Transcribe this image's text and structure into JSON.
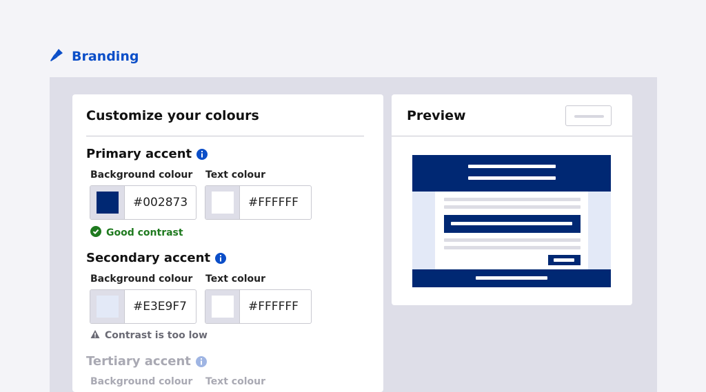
{
  "header": {
    "title": "Branding",
    "icon": "pen-nib-icon"
  },
  "customize": {
    "title": "Customize your colours",
    "primary": {
      "title": "Primary accent",
      "bg_label": "Background colour",
      "bg_value": "#002873",
      "text_label": "Text colour",
      "text_value": "#FFFFFF",
      "status": "Good contrast",
      "status_icon": "check-circle-icon"
    },
    "secondary": {
      "title": "Secondary accent",
      "bg_label": "Background colour",
      "bg_value": "#E3E9F7",
      "text_label": "Text colour",
      "text_value": "#FFFFFF",
      "status": "Contrast is too low",
      "status_icon": "warning-icon"
    },
    "tertiary": {
      "title": "Tertiary accent",
      "bg_label": "Background colour",
      "text_label": "Text colour"
    }
  },
  "preview": {
    "title": "Preview"
  },
  "colors": {
    "accent": "#0b4ec8",
    "primary": "#002873",
    "secondary": "#E3E9F7",
    "good": "#1f7a1f",
    "warning": "#6a6a74"
  }
}
